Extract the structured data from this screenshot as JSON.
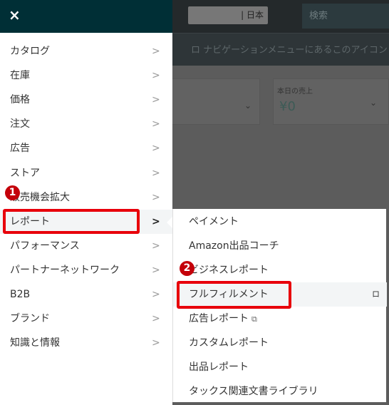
{
  "background": {
    "store_selector": "| 日本",
    "search_placeholder": "検索",
    "notice": "ロ ナビゲーションメニューにあるこのアイコン",
    "card_sales_label": "本日の売上",
    "card_sales_value": "¥0"
  },
  "menu": {
    "close_icon": "×",
    "items": [
      {
        "label": "カタログ"
      },
      {
        "label": "在庫"
      },
      {
        "label": "価格"
      },
      {
        "label": "注文"
      },
      {
        "label": "広告"
      },
      {
        "label": "ストア"
      },
      {
        "label": "販売機会拡大"
      },
      {
        "label": "レポート",
        "active": true
      },
      {
        "label": "パフォーマンス"
      },
      {
        "label": "パートナーネットワーク"
      },
      {
        "label": "B2B"
      },
      {
        "label": "ブランド"
      },
      {
        "label": "知識と情報"
      }
    ],
    "arrow": ">"
  },
  "submenu": {
    "items": [
      {
        "label": "ペイメント"
      },
      {
        "label": "Amazon出品コーチ"
      },
      {
        "label": "ビジネスレポート"
      },
      {
        "label": "フルフィルメント",
        "highlighted": true,
        "pin": "ロ"
      },
      {
        "label": "広告レポート",
        "external": true
      },
      {
        "label": "カスタムレポート"
      },
      {
        "label": "出品レポート"
      },
      {
        "label": "タックス関連文書ライブラリ"
      }
    ]
  },
  "annotations": {
    "badge1": "1",
    "badge2": "2",
    "highlight_color": "#e8000b"
  },
  "colors": {
    "menu_header": "#002f36",
    "overlay": "#5c5c5c"
  }
}
